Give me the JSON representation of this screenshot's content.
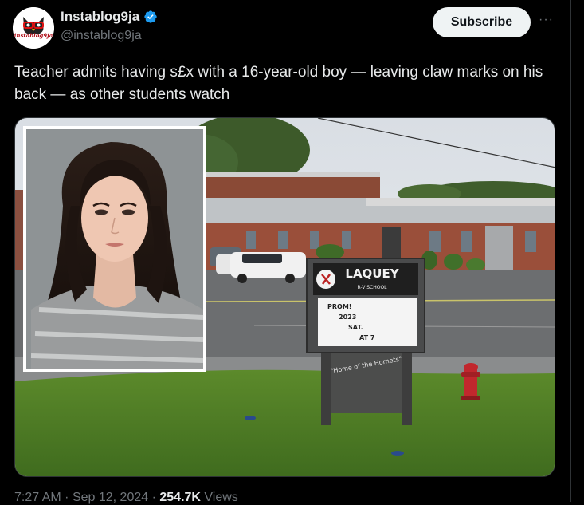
{
  "author": {
    "display_name": "Instablog9ja",
    "handle": "@instablog9ja",
    "avatar_text": "instablog9ja",
    "verified_icon": "verified-badge-icon"
  },
  "actions": {
    "subscribe_label": "Subscribe",
    "more_icon": "more-icon"
  },
  "tweet": {
    "text": "Teacher admits having s£x with a 16-year-old boy — leaving claw marks on his back — as other students watch"
  },
  "media": {
    "sign_name": "LAQUEY",
    "sign_subtitle": "R-V SCHOOL",
    "marquee_lines": [
      "PROM!",
      "2023",
      "SAT.",
      "AT 7"
    ],
    "sign_slogan": "\"Home of the Hornets\""
  },
  "meta": {
    "time": "7:27 AM",
    "date": "Sep 12, 2024",
    "views_count": "254.7K",
    "views_label": "Views"
  },
  "colors": {
    "background": "#000000",
    "accent_verified": "#1d9bf0",
    "subscribe_bg": "#eff3f4",
    "secondary_text": "#71767b"
  }
}
